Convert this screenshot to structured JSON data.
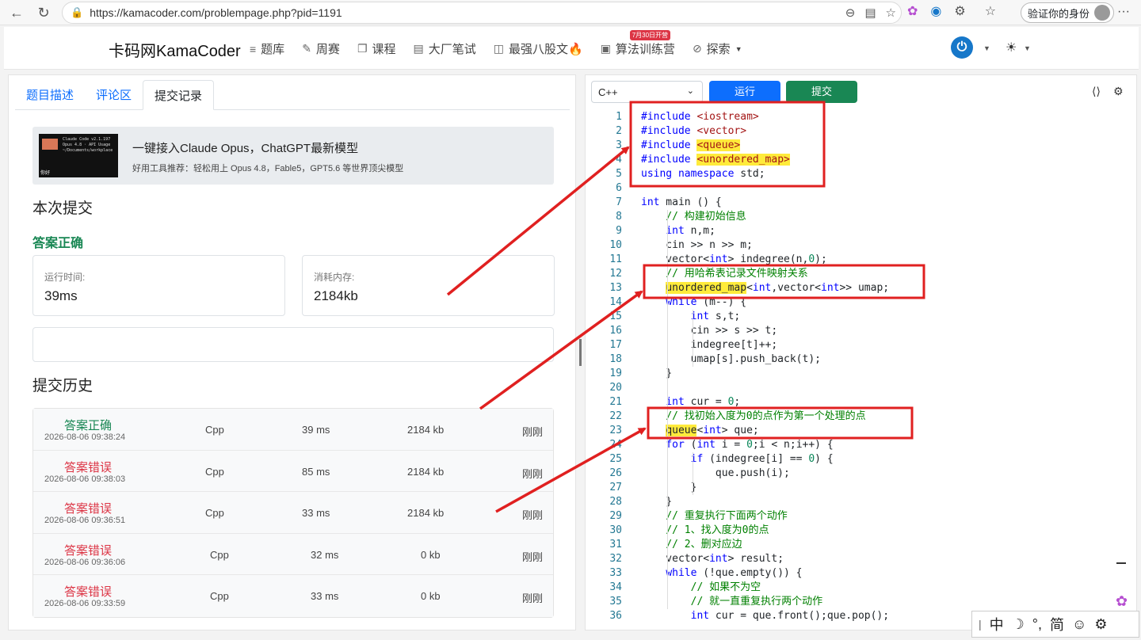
{
  "browser": {
    "url": "https://kamacoder.com/problempage.php?pid=1191",
    "profile_label": "验证你的身份"
  },
  "site": {
    "brand": "卡码网KamaCoder",
    "nav": [
      {
        "label": "题库",
        "icon": "list-icon"
      },
      {
        "label": "周赛",
        "icon": "pencil-icon"
      },
      {
        "label": "课程",
        "icon": "copy-icon"
      },
      {
        "label": "大厂笔试",
        "icon": "document-icon"
      },
      {
        "label": "最强八股文🔥",
        "icon": "code-file-icon"
      },
      {
        "label": "算法训练营",
        "icon": "calendar-icon",
        "badge": "7月30日开营"
      },
      {
        "label": "探索",
        "icon": "compass-icon"
      }
    ]
  },
  "left": {
    "tabs": [
      "题目描述",
      "评论区",
      "提交记录"
    ],
    "active_tab": 2,
    "ad": {
      "title": "一键接入Claude Opus，ChatGPT最新模型",
      "subtitle": "好用工具推荐：轻松用上 Opus 4.8，Fable5，GPT5.6 等世界顶尖模型",
      "thumb_lines": [
        "Claude Code v2.1.197",
        "Opus 4.8 · API Usage",
        "~/Documents/workplace"
      ],
      "thumb_tag": "你好"
    },
    "current_submission_title": "本次提交",
    "result": "答案正确",
    "runtime_label": "运行时间:",
    "runtime_value": "39ms",
    "memory_label": "消耗内存:",
    "memory_value": "2184kb",
    "history_title": "提交历史",
    "history": [
      {
        "status": "答案正确",
        "ok": true,
        "time": "2026-08-06 09:38:24",
        "lang": "Cpp",
        "runtime": "39 ms",
        "memory": "2184 kb",
        "when": "刚刚"
      },
      {
        "status": "答案错误",
        "ok": false,
        "time": "2026-08-06 09:38:03",
        "lang": "Cpp",
        "runtime": "85 ms",
        "memory": "2184 kb",
        "when": "刚刚"
      },
      {
        "status": "答案错误",
        "ok": false,
        "time": "2026-08-06 09:36:51",
        "lang": "Cpp",
        "runtime": "33 ms",
        "memory": "2184 kb",
        "when": "刚刚"
      },
      {
        "status": "答案错误",
        "ok": false,
        "time": "2026-08-06 09:36:06",
        "lang": "Cpp",
        "runtime": "32 ms",
        "memory": "0 kb",
        "when": "刚刚"
      },
      {
        "status": "答案错误",
        "ok": false,
        "time": "2026-08-06 09:33:59",
        "lang": "Cpp",
        "runtime": "33 ms",
        "memory": "0 kb",
        "when": "刚刚"
      }
    ]
  },
  "editor": {
    "language": "C++",
    "run_label": "运行",
    "submit_label": "提交",
    "lines": [
      "#include <iostream>",
      "#include <vector>",
      "#include <queue>",
      "#include <unordered_map>",
      "using namespace std;",
      "",
      "int main () {",
      "    // 构建初始信息",
      "    int n,m;",
      "    cin >> n >> m;",
      "    vector<int> indegree(n,0);",
      "    // 用哈希表记录文件映射关系",
      "    unordered_map<int,vector<int>> umap;",
      "    while (m--) {",
      "        int s,t;",
      "        cin >> s >> t;",
      "        indegree[t]++;",
      "        umap[s].push_back(t);",
      "    }",
      "",
      "    int cur = 0;",
      "    // 找初始入度为0的点作为第一个处理的点",
      "    queue<int> que;",
      "    for (int i = 0;i < n;i++) {",
      "        if (indegree[i] == 0) {",
      "            que.push(i);",
      "        }",
      "    }",
      "    // 重复执行下面两个动作",
      "    // 1、找入度为0的点",
      "    // 2、删对应边",
      "    vector<int> result;",
      "    while (!que.empty()) {",
      "        // 如果不为空",
      "        // 就一直重复执行两个动作",
      "        int cur = que.front();que.pop();"
    ],
    "highlights": [
      "queue",
      "unordered_map"
    ]
  },
  "ime": {
    "items": [
      "中",
      "☽",
      "°,",
      "简",
      "☺",
      "⚙"
    ]
  },
  "colors": {
    "success": "#198754",
    "danger": "#dc3545",
    "primary": "#0d6efd",
    "annotation": "#e02020",
    "highlight": "#ffeb3b"
  }
}
